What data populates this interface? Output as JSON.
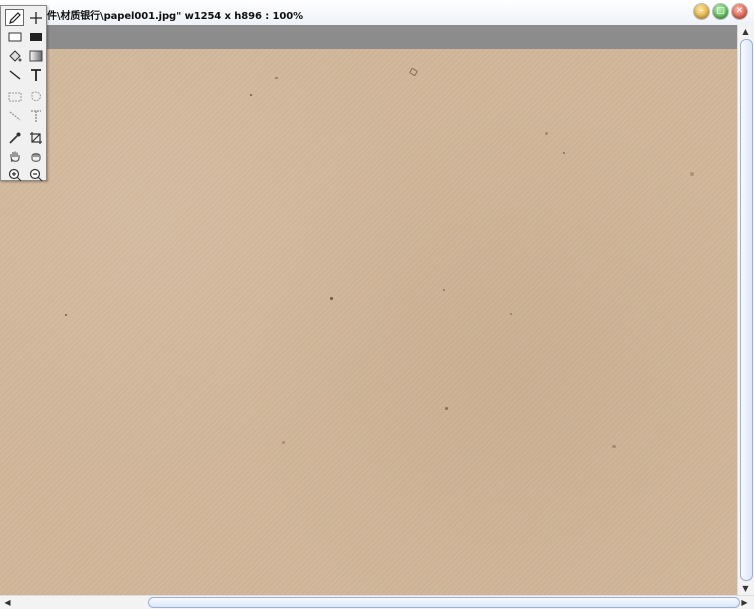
{
  "window": {
    "title": "件\\材质银行\\papel001.jpg\" w1254 x h896 : 100%",
    "buttons": {
      "minimize": "minimize-icon",
      "maximize": "maximize-icon",
      "close": "close-icon"
    }
  },
  "image": {
    "file": "papel001.jpg",
    "texture": "paper-texture",
    "base_color": "#d1b699"
  },
  "toolbox": {
    "tools": [
      {
        "name": "pencil-tool",
        "icon": "pencil-icon",
        "selected": true
      },
      {
        "name": "move-tool",
        "icon": "move-cross-icon"
      },
      {
        "name": "rectangle-tool",
        "icon": "rectangle-outline-icon"
      },
      {
        "name": "filled-rectangle-tool",
        "icon": "filled-rectangle-icon"
      },
      {
        "name": "paint-bucket-tool",
        "icon": "paint-bucket-icon"
      },
      {
        "name": "gradient-tool",
        "icon": "gradient-icon"
      },
      {
        "name": "line-tool",
        "icon": "line-icon"
      },
      {
        "name": "text-tool",
        "icon": "text-icon",
        "glyph": "T"
      },
      {
        "name": "rect-select-tool",
        "icon": "rect-select-icon"
      },
      {
        "name": "lasso-tool",
        "icon": "lasso-icon"
      },
      {
        "name": "line-select-tool",
        "icon": "line-select-icon"
      },
      {
        "name": "text-select-tool",
        "icon": "text-select-icon",
        "glyph": "T"
      },
      {
        "name": "eyedropper-tool",
        "icon": "eyedropper-icon"
      },
      {
        "name": "crop-tool",
        "icon": "crop-icon"
      },
      {
        "name": "hand-tool",
        "icon": "hand-icon"
      },
      {
        "name": "grab-tool",
        "icon": "grab-hand-icon"
      },
      {
        "name": "zoom-in-tool",
        "icon": "zoom-in-icon"
      },
      {
        "name": "zoom-out-tool",
        "icon": "zoom-out-icon"
      }
    ]
  },
  "colors": {
    "titlebar": "#eef2f8",
    "gray_strip": "#8c8c8c",
    "scroll_thumb_border": "#9ab0d8"
  }
}
